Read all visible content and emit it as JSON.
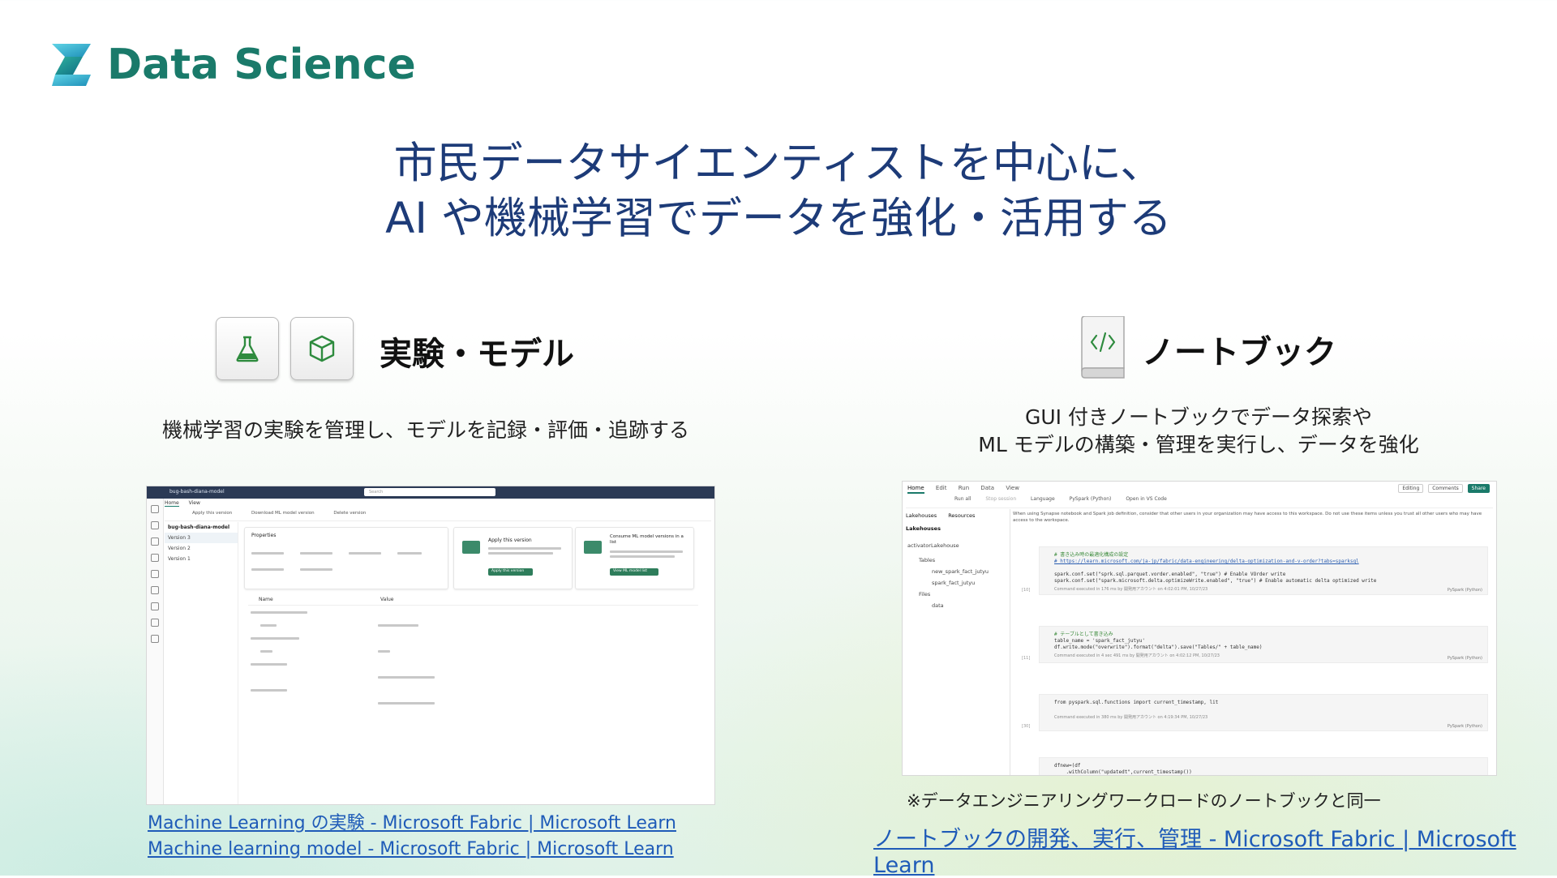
{
  "brand": {
    "title": "Data Science"
  },
  "headline": {
    "line1": "市民データサイエンティストを中心に、",
    "line2": "AI や機械学習でデータを強化・活用する"
  },
  "left": {
    "title": "実験・モデル",
    "description": "機械学習の実験を管理し、モデルを記録・評価・追跡する",
    "screenshot": {
      "top_title": "bug-bash-diana-model",
      "search_placeholder": "Search",
      "tabs": [
        "Home",
        "View"
      ],
      "toolbar": [
        "Apply this version",
        "Download ML model version",
        "Delete version"
      ],
      "list_header": "bug-bash-diana-model",
      "versions": [
        "Version 3",
        "Version 2",
        "Version 1"
      ],
      "properties_title": "Properties",
      "apply_card_title": "Apply this version",
      "apply_button": "Apply this version",
      "consume_card_title": "Consume ML model versions in a list",
      "consume_button": "View ML model list",
      "table_headers": [
        "Name",
        "Value"
      ]
    }
  },
  "right": {
    "title": "ノートブック",
    "description_line1": "GUI 付きノートブックでデータ探索や",
    "description_line2": "ML モデルの構築・管理を実行し、データを強化",
    "note": "※データエンジニアリングワークロードのノートブックと同一",
    "screenshot": {
      "menu": [
        "Home",
        "Edit",
        "Run",
        "Data",
        "View"
      ],
      "right_buttons": [
        "Editing",
        "Comments",
        "Share"
      ],
      "toolbar": [
        "Run all",
        "Stop session",
        "Language",
        "PySpark (Python)",
        "Open in VS Code"
      ],
      "side_tabs": [
        "Lakehouses",
        "Resources"
      ],
      "side_header": "Lakehouses",
      "lakehouse": "activatorLakehouse",
      "tree": [
        "Tables",
        "new_spark_fact_jutyu",
        "spark_fact_jutyu",
        "Files",
        "data"
      ],
      "banner": "When using Synapse notebook and Spark job definition, consider that other users in your organization may have access to this workspace. Do not use these items unless you trust all other users who may have access to the workspace.",
      "cells": [
        {
          "lines": [
            "# 書き込み時の最適化構成の設定",
            "# https://learn.microsoft.com/ja-jp/fabric/data-engineering/delta-optimization-and-v-order?tabs=sparksql",
            "",
            "spark.conf.set(\"sprk.sql.parquet.vorder.enabled\", \"true\") # Enable VOrder write",
            "spark.conf.set(\"spark.microsoft.delta.optimizeWrite.enabled\", \"true\") # Enable automatic delta optimized write"
          ],
          "status": "Command executed in 176 ms by 開発用アカウント on 4:02:01 PM, 10/27/23",
          "num": "[10]",
          "lang": "PySpark (Python)"
        },
        {
          "lines": [
            "# テーブルとして書き込み",
            "table_name = 'spark_fact_jutyu'",
            "df.write.mode(\"overwrite\").format(\"delta\").save(\"Tables/\" + table_name)"
          ],
          "status": "Command executed in 4 sec 491 ms by 開発用アカウント on 4:02:12 PM, 10/27/23",
          "num": "[11]",
          "lang": "PySpark (Python)"
        },
        {
          "lines": [
            "from pyspark.sql.functions import current_timestamp, lit",
            "",
            ""
          ],
          "status": "Command executed in 380 ms by 開発用アカウント on 4:19:34 PM, 10/27/23",
          "num": "[30]",
          "lang": "PySpark (Python)"
        },
        {
          "lines": [
            "dfnew=(df",
            "    .withColumn(\"updatedt\",current_timestamp())"
          ],
          "status": "",
          "num": "",
          "lang": ""
        }
      ]
    }
  },
  "links": {
    "ml_experiment": "Machine Learning の実験 - Microsoft Fabric | Microsoft Learn",
    "ml_model": "Machine learning model - Microsoft Fabric | Microsoft Learn",
    "notebook": "ノートブックの開発、実行、管理 - Microsoft Fabric | Microsoft Learn"
  },
  "colors": {
    "brand": "#1a7a6a",
    "headline": "#1d3b78",
    "link": "#1f5bb8"
  },
  "icons": [
    "data-science-logo-icon",
    "flask-icon",
    "cube-icon",
    "code-notebook-icon"
  ]
}
